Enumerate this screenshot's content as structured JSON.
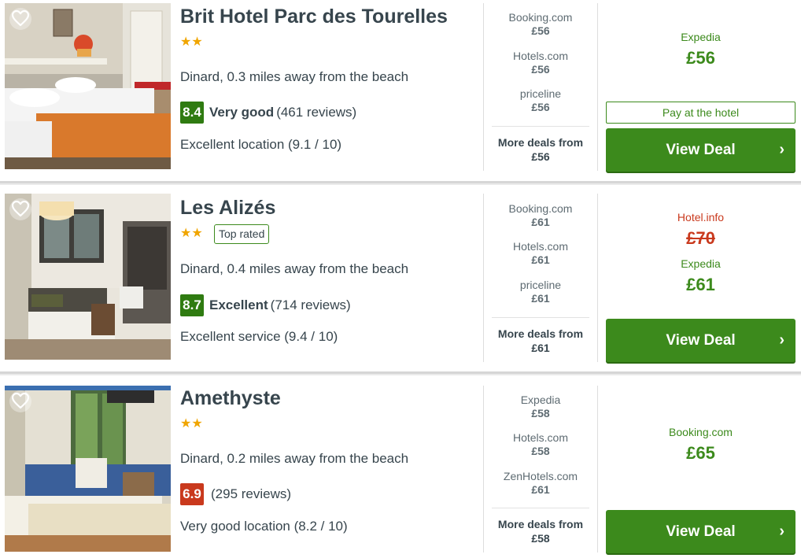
{
  "hotels": [
    {
      "name": "Brit Hotel Parc des Tourelles",
      "stars": "★★",
      "top_rated": null,
      "distance": "Dinard, 0.3 miles away from the beach",
      "score": "8.4",
      "rating_word": "Very good",
      "reviews": "(461 reviews)",
      "sub_rating": "Excellent location (9.1 / 10)",
      "deals": [
        {
          "provider": "Booking.com",
          "price": "£56"
        },
        {
          "provider": "Hotels.com",
          "price": "£56"
        },
        {
          "provider": "priceline",
          "price": "£56"
        }
      ],
      "more_label": "More deals from",
      "more_price": "£56",
      "best_provider": "Expedia",
      "best_price": "£56",
      "pay_at_hotel": "Pay at the hotel",
      "view_deal": "View Deal"
    },
    {
      "name": "Les Alizés",
      "stars": "★★",
      "top_rated": "Top rated",
      "distance": "Dinard, 0.4 miles away from the beach",
      "score": "8.7",
      "rating_word": "Excellent",
      "reviews": "(714 reviews)",
      "sub_rating": "Excellent service (9.4 / 10)",
      "deals": [
        {
          "provider": "Booking.com",
          "price": "£61"
        },
        {
          "provider": "Hotels.com",
          "price": "£61"
        },
        {
          "provider": "priceline",
          "price": "£61"
        }
      ],
      "more_label": "More deals from",
      "more_price": "£61",
      "strike_provider": "Hotel.info",
      "strike_price": "£70",
      "best_provider": "Expedia",
      "best_price": "£61",
      "view_deal": "View Deal"
    },
    {
      "name": "Amethyste",
      "stars": "★★",
      "top_rated": null,
      "distance": "Dinard, 0.2 miles away from the beach",
      "score": "6.9",
      "rating_word": "",
      "reviews": "(295 reviews)",
      "sub_rating": "Very good location (8.2 / 10)",
      "deals": [
        {
          "provider": "Expedia",
          "price": "£58"
        },
        {
          "provider": "Hotels.com",
          "price": "£58"
        },
        {
          "provider": "ZenHotels.com",
          "price": "£61"
        }
      ],
      "more_label": "More deals from",
      "more_price": "£58",
      "best_provider": "Booking.com",
      "best_price": "£65",
      "view_deal": "View Deal"
    }
  ],
  "icons": {
    "favourite": "heart-icon",
    "chevron": "chevron-right-icon",
    "chevron_glyph": "›"
  },
  "colors": {
    "deal_green": "#3c8a1c",
    "score_green": "#2f7b11",
    "score_red": "#c9391d",
    "star_gold": "#f0a500",
    "strike_red": "#c9391d"
  }
}
